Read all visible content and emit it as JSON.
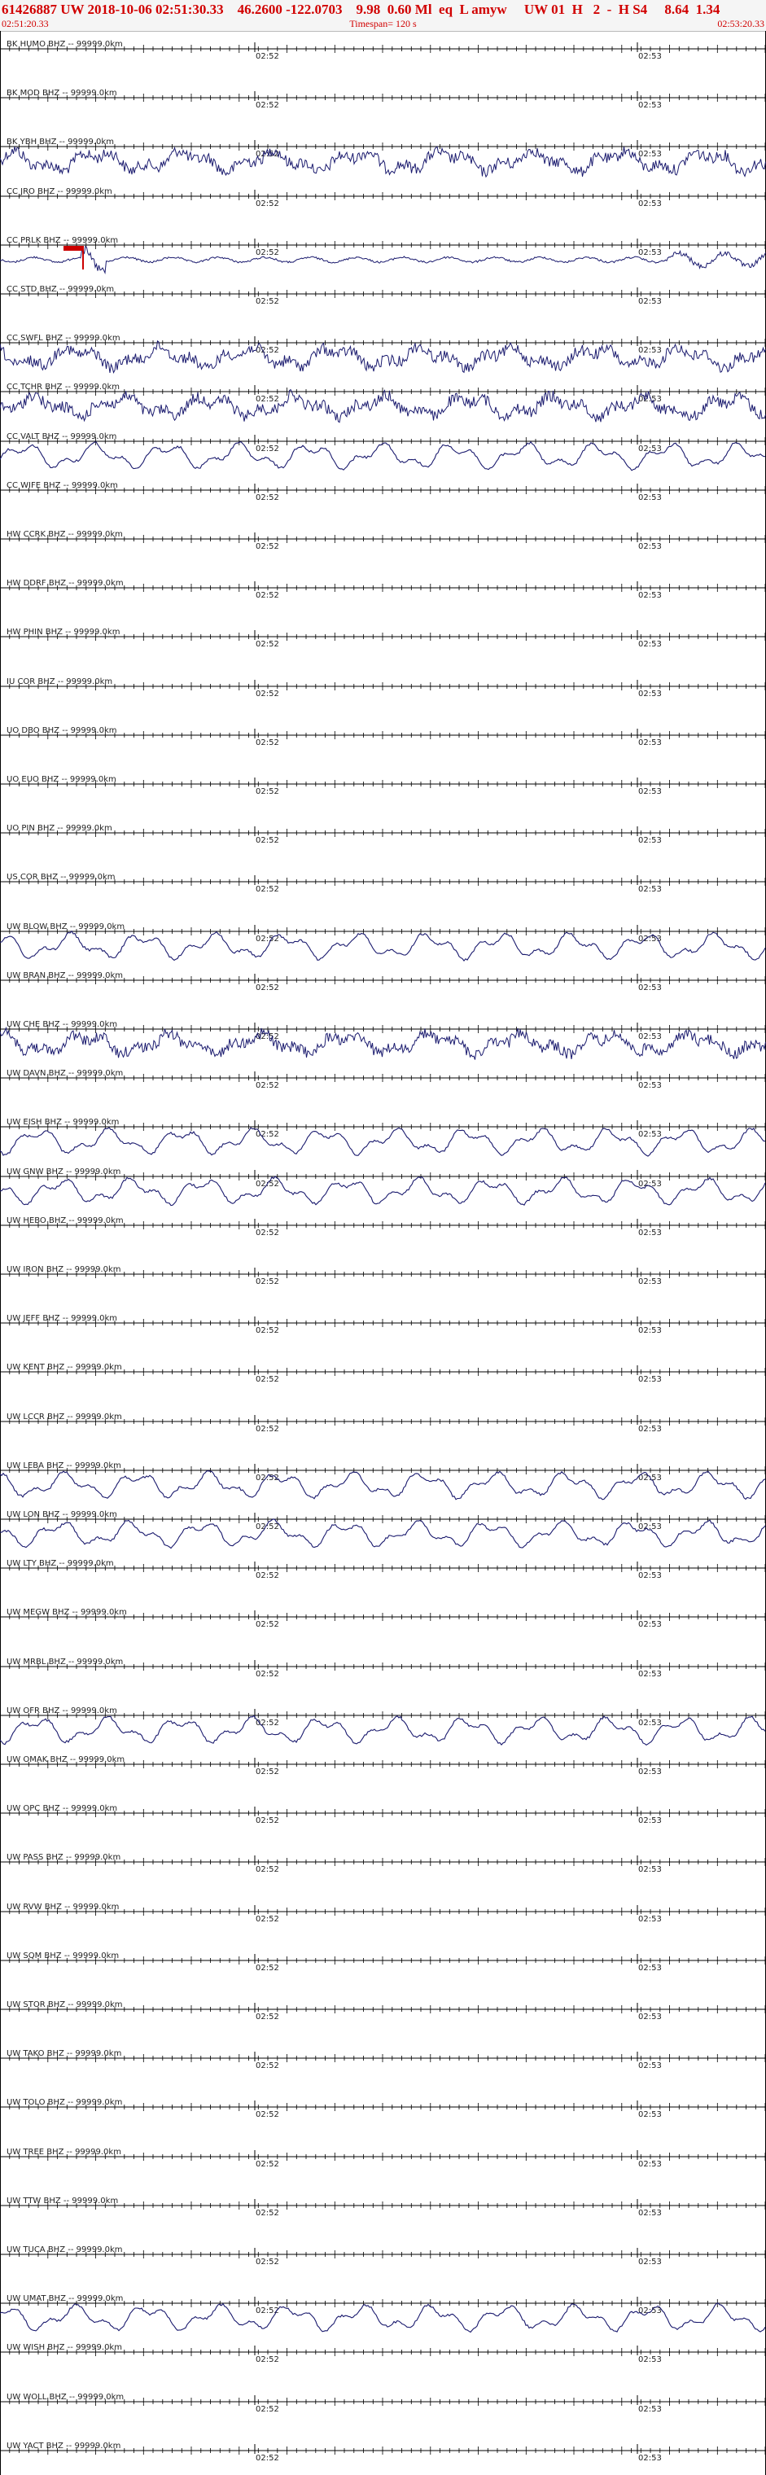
{
  "header": {
    "title": "61426887 UW 2018-10-06 02:51:30.33    46.2600 -122.0703    9.98  0.60 Ml  eq  L amyw     UW 01  H   2  -  H S4     8.64  1.34",
    "start_time": "02:51:20.33",
    "timespan": "Timespan= 120 s",
    "end_time": "02:53:20.33"
  },
  "tick_labels": [
    "02:52",
    "02:53"
  ],
  "colors": {
    "header_text": "#d10000",
    "trace": "#1a1a6e",
    "axis": "#000000",
    "pick": "#cc0000"
  },
  "channels": [
    {
      "label": "BK HUMO BHZ -- 99999.0km",
      "activity": "flat"
    },
    {
      "label": "BK MOD BHZ -- 99999.0km",
      "activity": "flat"
    },
    {
      "label": "BK YBH BHZ -- 99999.0km",
      "activity": "noisy"
    },
    {
      "label": "CC JRO BHZ -- 99999.0km",
      "activity": "flat"
    },
    {
      "label": "CC PRLK BHZ -- 99999.0km",
      "activity": "event",
      "pick": true
    },
    {
      "label": "CC STD BHZ -- 99999.0km",
      "activity": "flat"
    },
    {
      "label": "CC SWFL BHZ -- 99999.0km",
      "activity": "noisy"
    },
    {
      "label": "CC TCHR BHZ -- 99999.0km",
      "activity": "noisy"
    },
    {
      "label": "CC VALT BHZ -- 99999.0km",
      "activity": "wave"
    },
    {
      "label": "CC WIFE BHZ -- 99999.0km",
      "activity": "flat"
    },
    {
      "label": "HW CCRK BHZ -- 99999.0km",
      "activity": "flat"
    },
    {
      "label": "HW DDRF BHZ -- 99999.0km",
      "activity": "flat"
    },
    {
      "label": "HW PHIN BHZ -- 99999.0km",
      "activity": "flat"
    },
    {
      "label": "IU COR BHZ -- 99999.0km",
      "activity": "flat"
    },
    {
      "label": "UO DBO BHZ -- 99999.0km",
      "activity": "flat"
    },
    {
      "label": "UO EUO BHZ -- 99999.0km",
      "activity": "flat"
    },
    {
      "label": "UO PIN BHZ -- 99999.0km",
      "activity": "flat"
    },
    {
      "label": "US COR BHZ -- 99999.0km",
      "activity": "flat"
    },
    {
      "label": "UW BLOW BHZ -- 99999.0km",
      "activity": "wave"
    },
    {
      "label": "UW BRAN BHZ -- 99999.0km",
      "activity": "flat"
    },
    {
      "label": "UW CHE BHZ -- 99999.0km",
      "activity": "noisy"
    },
    {
      "label": "UW DAVN BHZ -- 99999.0km",
      "activity": "flat"
    },
    {
      "label": "UW EISH BHZ -- 99999.0km",
      "activity": "wave"
    },
    {
      "label": "UW GNW BHZ -- 99999.0km",
      "activity": "wave"
    },
    {
      "label": "UW HEBO BHZ -- 99999.0km",
      "activity": "flat"
    },
    {
      "label": "UW IRON BHZ -- 99999.0km",
      "activity": "flat"
    },
    {
      "label": "UW JEFF BHZ -- 99999.0km",
      "activity": "flat"
    },
    {
      "label": "UW KENT BHZ -- 99999.0km",
      "activity": "flat"
    },
    {
      "label": "UW LCCR BHZ -- 99999.0km",
      "activity": "flat"
    },
    {
      "label": "UW LEBA BHZ -- 99999.0km",
      "activity": "wave"
    },
    {
      "label": "UW LON BHZ -- 99999.0km",
      "activity": "wave"
    },
    {
      "label": "UW LTY BHZ -- 99999.0km",
      "activity": "flat"
    },
    {
      "label": "UW MEGW BHZ -- 99999.0km",
      "activity": "flat"
    },
    {
      "label": "UW MRBL BHZ -- 99999.0km",
      "activity": "flat"
    },
    {
      "label": "UW OFR BHZ -- 99999.0km",
      "activity": "wave"
    },
    {
      "label": "UW OMAK BHZ -- 99999.0km",
      "activity": "flat"
    },
    {
      "label": "UW OPC BHZ -- 99999.0km",
      "activity": "flat"
    },
    {
      "label": "UW PASS BHZ -- 99999.0km",
      "activity": "flat"
    },
    {
      "label": "UW RVW BHZ -- 99999.0km",
      "activity": "flat"
    },
    {
      "label": "UW SQM BHZ -- 99999.0km",
      "activity": "flat"
    },
    {
      "label": "UW STOR BHZ -- 99999.0km",
      "activity": "flat"
    },
    {
      "label": "UW TAKO BHZ -- 99999.0km",
      "activity": "flat"
    },
    {
      "label": "UW TOLO BHZ -- 99999.0km",
      "activity": "flat"
    },
    {
      "label": "UW TREE BHZ -- 99999.0km",
      "activity": "flat"
    },
    {
      "label": "UW TTW BHZ -- 99999.0km",
      "activity": "flat"
    },
    {
      "label": "UW TUCA BHZ -- 99999.0km",
      "activity": "flat"
    },
    {
      "label": "UW UMAT BHZ -- 99999.0km",
      "activity": "wave"
    },
    {
      "label": "UW WISH BHZ -- 99999.0km",
      "activity": "flat"
    },
    {
      "label": "UW WOLL BHZ -- 99999.0km",
      "activity": "flat"
    },
    {
      "label": "UW YACT BHZ -- 99999.0km",
      "activity": "flat"
    }
  ]
}
